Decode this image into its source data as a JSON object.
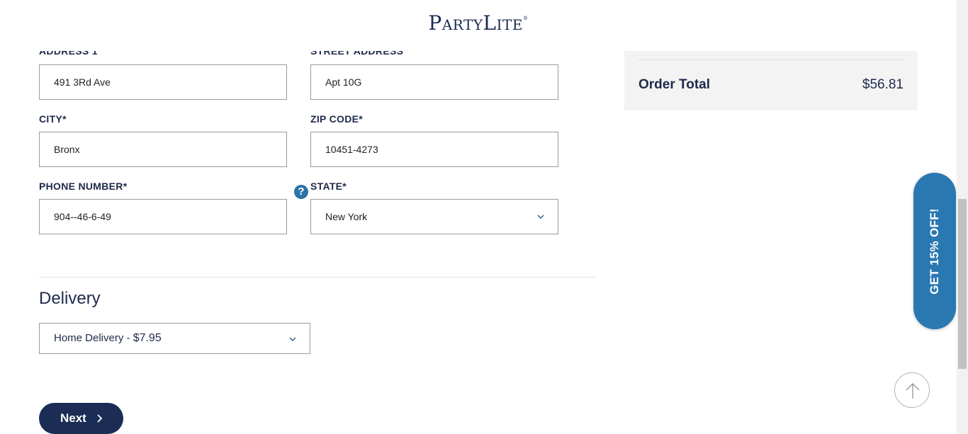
{
  "brand": {
    "logo_text": "PartyLite",
    "logo_mark": "®"
  },
  "address_form": {
    "address1": {
      "label": "ADDRESS 1",
      "value": "491 3Rd Ave"
    },
    "street": {
      "label": "STREET ADDRESS",
      "value": "Apt 10G"
    },
    "city": {
      "label": "CITY*",
      "value": "Bronx"
    },
    "zip": {
      "label": "ZIP CODE*",
      "value": "10451-4273"
    },
    "phone": {
      "label": "PHONE NUMBER*",
      "value": "904--46-6-49",
      "help_glyph": "?"
    },
    "state": {
      "label": "STATE*",
      "value": "New York"
    }
  },
  "delivery": {
    "title": "Delivery",
    "option_name": "Home Delivery - ",
    "option_price": "$7.95"
  },
  "next_button": {
    "label": "Next"
  },
  "order_summary": {
    "total_label": "Order Total",
    "total_value": "$56.81"
  },
  "promo": {
    "label": "GET 15% OFF!"
  },
  "colors": {
    "navy": "#1b2d55",
    "promo_blue": "#2a78b2",
    "help_blue": "#2d74a8"
  },
  "icons": [
    "chevron-down-icon",
    "chevron-right-icon",
    "arrow-up-icon",
    "help-icon"
  ]
}
